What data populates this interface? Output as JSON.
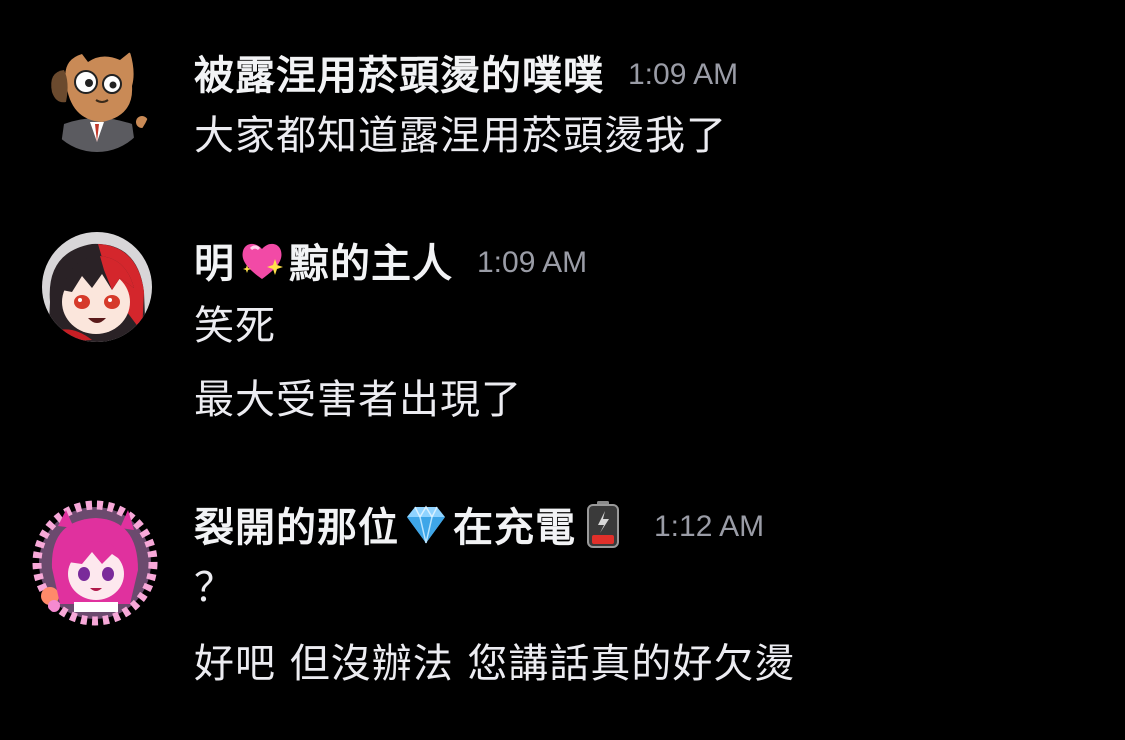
{
  "messages": [
    {
      "username_parts": [
        "被露涅用菸頭燙的噗噗"
      ],
      "avatar_icon": "dog-in-suit-avatar",
      "timestamp": "1:09 AM",
      "lines": [
        "大家都知道露涅用菸頭燙我了"
      ]
    },
    {
      "username_parts": [
        "明",
        "黥的主人"
      ],
      "username_emoji": "sparkling-heart-emoji",
      "avatar_icon": "red-hair-girl-avatar",
      "timestamp": "1:09 AM",
      "lines": [
        "笑死",
        "最大受害者出現了"
      ]
    },
    {
      "username_parts": [
        "裂開的那位",
        "在充電"
      ],
      "username_emojis": [
        "gem-stone-emoji",
        "low-battery-emoji"
      ],
      "avatar_icon": "pink-hair-girl-avatar",
      "timestamp": "1:12 AM",
      "lines": [
        "？",
        "好吧 但沒辦法 您講話真的好欠燙"
      ]
    }
  ],
  "colors": {
    "background": "#000000",
    "username": "#f2f3f5",
    "message_text": "#ececf1",
    "timestamp": "#9a9ca6"
  }
}
